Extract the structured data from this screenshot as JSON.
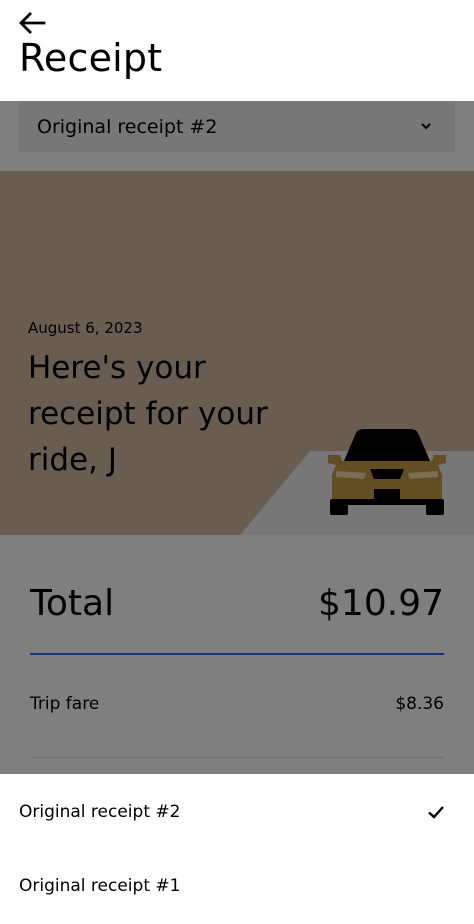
{
  "header": {
    "back_icon": "arrow-left-icon",
    "title": "Receipt"
  },
  "receipt_selector": {
    "selected": "Original receipt #2",
    "icon": "chevron-down-icon"
  },
  "hero": {
    "date": "August 6, 2023",
    "heading": "Here's your receipt for your ride, J",
    "illustration": "car-icon",
    "background_color": "#d1bba0"
  },
  "summary": {
    "total_label": "Total",
    "total_value": "$10.97",
    "lines": [
      {
        "label": "Trip fare",
        "value": "$8.36"
      }
    ]
  },
  "bottom_sheet": {
    "options": [
      {
        "label": "Original receipt #2",
        "selected": true,
        "icon": "checkmark-icon"
      },
      {
        "label": "Original receipt #1",
        "selected": false
      }
    ]
  }
}
